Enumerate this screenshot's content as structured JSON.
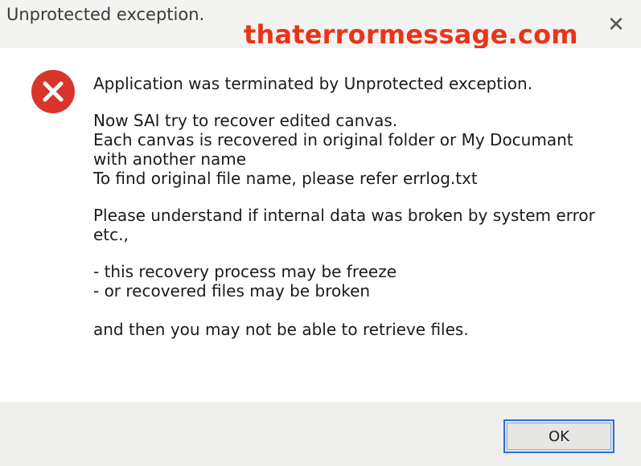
{
  "window": {
    "title": "Unprotected exception.",
    "close_symbol": "✕"
  },
  "watermark": "thaterrormessage.com",
  "icon": {
    "name": "error-icon",
    "color": "#d9362b"
  },
  "message": {
    "line1": "Application was terminated by Unprotected exception.",
    "line2": "Now SAI try to recover edited canvas.",
    "line3": "Each canvas is recovered in original folder or My Documant",
    "line4": "with another name",
    "line5": "To find original file name, please refer errlog.txt",
    "line6": "Please understand if internal data was broken by system error",
    "line7": "etc.,",
    "line8": "- this recovery process may be freeze",
    "line9": "- or recovered files may be broken",
    "line10": "and then you may not be able to retrieve files."
  },
  "buttons": {
    "ok_label": "OK"
  },
  "colors": {
    "watermark": "#e8351a",
    "focus_border": "#2e6fd6"
  }
}
